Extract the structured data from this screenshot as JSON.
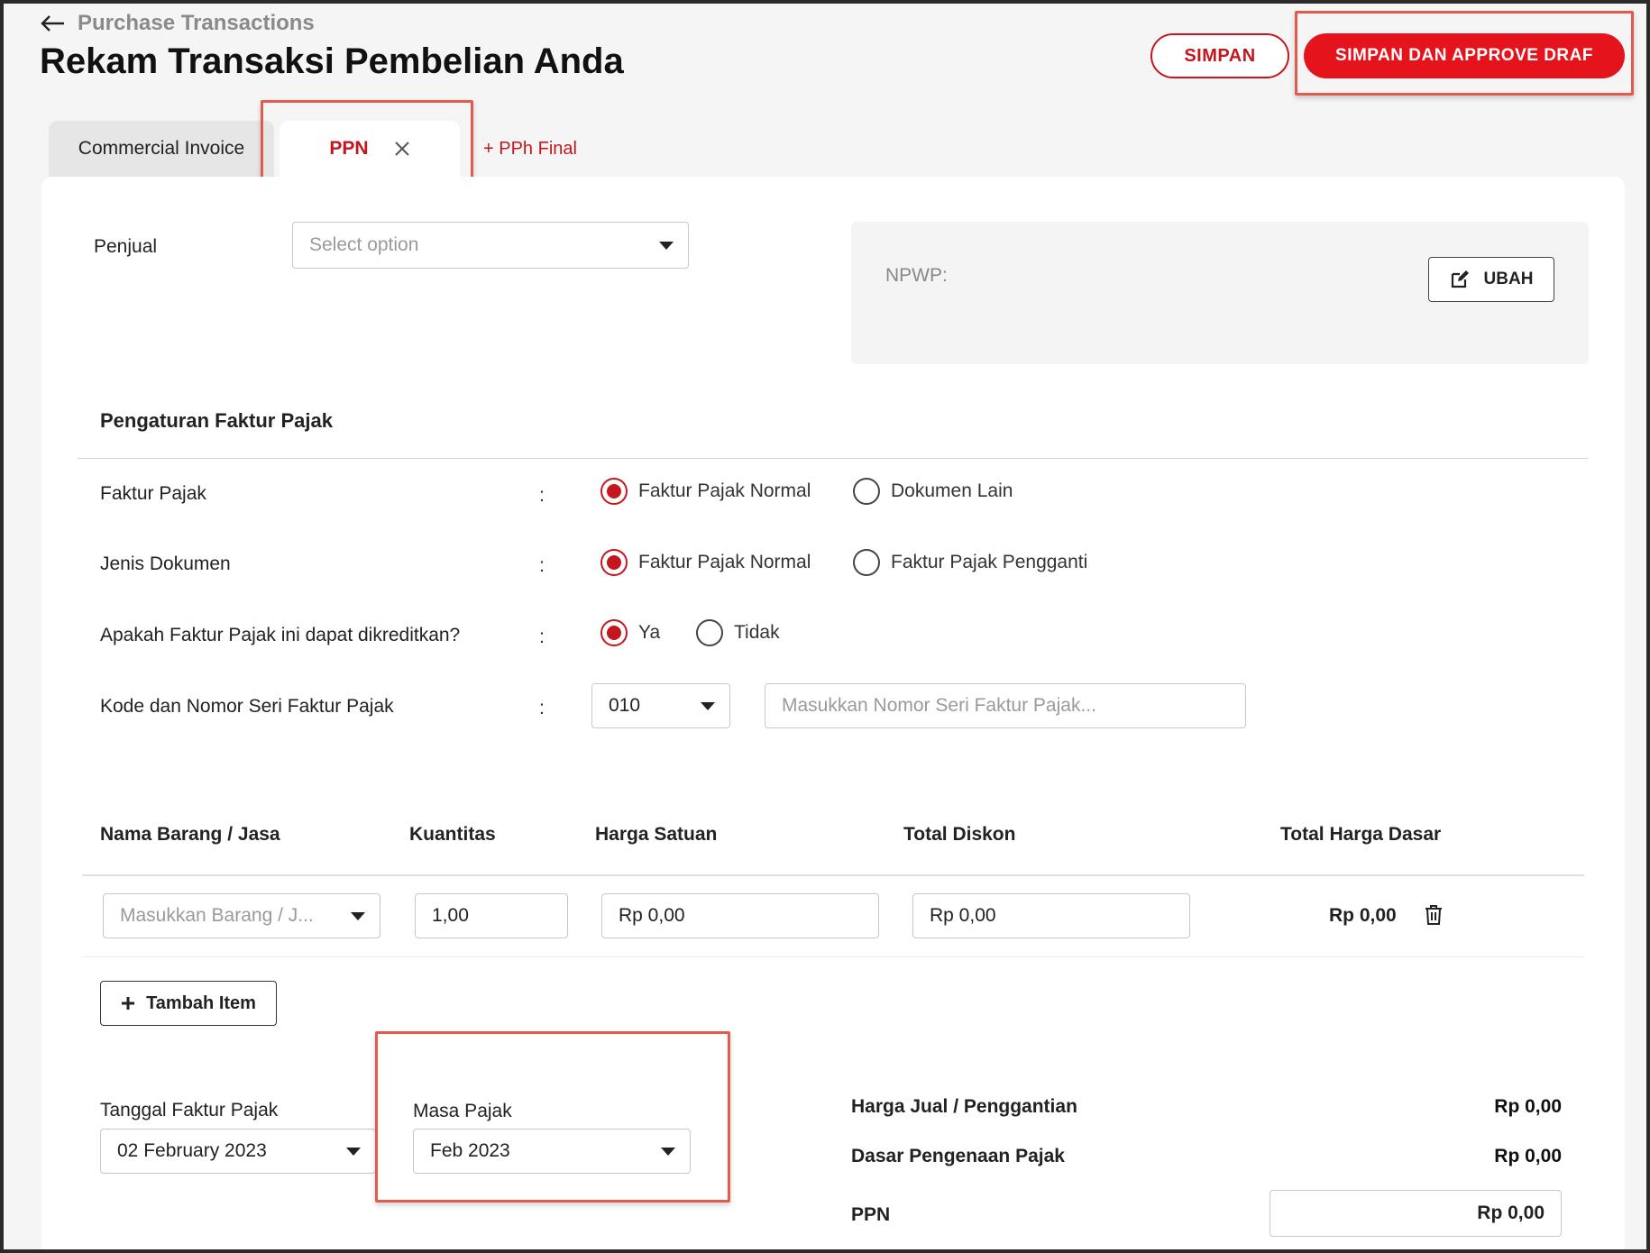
{
  "header": {
    "back_label": "Purchase Transactions",
    "title": "Rekam Transaksi Pembelian Anda",
    "save_label": "SIMPAN",
    "save_approve_label": "SIMPAN DAN APPROVE DRAF"
  },
  "tabs": {
    "commercial_invoice": "Commercial Invoice",
    "ppn": "PPN",
    "add_pph": "+ PPh Final"
  },
  "seller": {
    "label": "Penjual",
    "placeholder": "Select option",
    "npwp_label": "NPWP:",
    "edit_label": "UBAH"
  },
  "tax_invoice_settings": {
    "heading": "Pengaturan Faktur Pajak",
    "rows": [
      {
        "label": "Faktur Pajak",
        "options": [
          "Faktur Pajak Normal",
          "Dokumen Lain"
        ],
        "selected": 0
      },
      {
        "label": "Jenis Dokumen",
        "options": [
          "Faktur Pajak Normal",
          "Faktur Pajak Pengganti"
        ],
        "selected": 0
      },
      {
        "label": "Apakah Faktur Pajak ini dapat dikreditkan?",
        "options": [
          "Ya",
          "Tidak"
        ],
        "selected": 0
      }
    ],
    "code_label": "Kode dan Nomor Seri Faktur Pajak",
    "code_value": "010",
    "serial_placeholder": "Masukkan Nomor Seri Faktur Pajak...",
    "colon": ":"
  },
  "items_table": {
    "headers": [
      "Nama Barang / Jasa",
      "Kuantitas",
      "Harga Satuan",
      "Total Diskon",
      "Total Harga Dasar"
    ],
    "row": {
      "item_placeholder": "Masukkan Barang / J...",
      "quantity": "1,00",
      "unit_price": "Rp 0,00",
      "discount": "Rp 0,00",
      "total": "Rp 0,00"
    },
    "add_item_label": "Tambah Item"
  },
  "dates": {
    "invoice_date_label": "Tanggal Faktur Pajak",
    "invoice_date_value": "02 February 2023",
    "tax_period_label": "Masa Pajak",
    "tax_period_value": "Feb 2023"
  },
  "summary": {
    "selling_price_label": "Harga Jual / Penggantian",
    "selling_price_value": "Rp 0,00",
    "tax_base_label": "Dasar Pengenaan Pajak",
    "tax_base_value": "Rp 0,00",
    "ppn_label": "PPN",
    "ppn_value": "Rp 0,00"
  },
  "colors": {
    "accent": "#e5141c",
    "accent_dark": "#c4171d",
    "highlight": "#e25b4c"
  }
}
